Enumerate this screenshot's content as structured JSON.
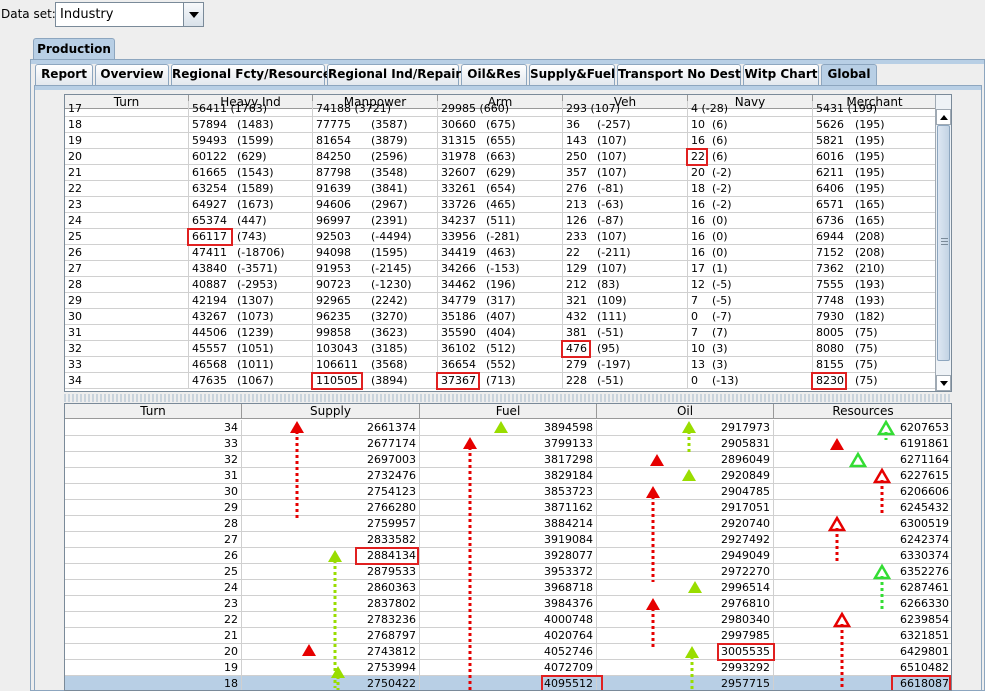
{
  "dataset": {
    "label": "Data set:",
    "value": "Industry"
  },
  "outer_tab": "Production",
  "tabs": [
    "Report",
    "Overview",
    "Regional Fcty/Resources",
    "Regional Ind/Repair",
    "Oil&Res",
    "Supply&Fuel",
    "Transport No Dest",
    "Witp Chart",
    "Global"
  ],
  "selected_tab": "Global",
  "production_table": {
    "columns": [
      "Turn",
      "Heavy Ind",
      "Manpower",
      "Arm",
      "Veh",
      "Navy",
      "Merchant"
    ],
    "partial_top_row": [
      "17",
      "56411 (1763)",
      "74188 (3721)",
      "29985 (660)",
      "293 (107)",
      "4 (-28)",
      "5431 (199)"
    ],
    "rows": [
      [
        "18",
        "57894",
        "(1483)",
        "77775",
        "(3587)",
        "30660",
        "(675)",
        "36",
        "(-257)",
        "10",
        "(6)",
        "5626",
        "(195)"
      ],
      [
        "19",
        "59493",
        "(1599)",
        "81654",
        "(3879)",
        "31315",
        "(655)",
        "143",
        "(107)",
        "16",
        "(6)",
        "5821",
        "(195)"
      ],
      [
        "20",
        "60122",
        "(629)",
        "84250",
        "(2596)",
        "31978",
        "(663)",
        "250",
        "(107)",
        "22",
        "(6)",
        "6016",
        "(195)"
      ],
      [
        "21",
        "61665",
        "(1543)",
        "87798",
        "(3548)",
        "32607",
        "(629)",
        "357",
        "(107)",
        "20",
        "(-2)",
        "6211",
        "(195)"
      ],
      [
        "22",
        "63254",
        "(1589)",
        "91639",
        "(3841)",
        "33261",
        "(654)",
        "276",
        "(-81)",
        "18",
        "(-2)",
        "6406",
        "(195)"
      ],
      [
        "23",
        "64927",
        "(1673)",
        "94606",
        "(2967)",
        "33726",
        "(465)",
        "213",
        "(-63)",
        "16",
        "(-2)",
        "6571",
        "(165)"
      ],
      [
        "24",
        "65374",
        "(447)",
        "96997",
        "(2391)",
        "34237",
        "(511)",
        "126",
        "(-87)",
        "16",
        "(0)",
        "6736",
        "(165)"
      ],
      [
        "25",
        "66117",
        "(743)",
        "92503",
        "(-4494)",
        "33956",
        "(-281)",
        "233",
        "(107)",
        "16",
        "(0)",
        "6944",
        "(208)"
      ],
      [
        "26",
        "47411",
        "(-18706)",
        "94098",
        "(1595)",
        "34419",
        "(463)",
        "22",
        "(-211)",
        "16",
        "(0)",
        "7152",
        "(208)"
      ],
      [
        "27",
        "43840",
        "(-3571)",
        "91953",
        "(-2145)",
        "34266",
        "(-153)",
        "129",
        "(107)",
        "17",
        "(1)",
        "7362",
        "(210)"
      ],
      [
        "28",
        "40887",
        "(-2953)",
        "90723",
        "(-1230)",
        "34462",
        "(196)",
        "212",
        "(83)",
        "12",
        "(-5)",
        "7555",
        "(193)"
      ],
      [
        "29",
        "42194",
        "(1307)",
        "92965",
        "(2242)",
        "34779",
        "(317)",
        "321",
        "(109)",
        "7",
        "(-5)",
        "7748",
        "(193)"
      ],
      [
        "30",
        "43267",
        "(1073)",
        "96235",
        "(3270)",
        "35186",
        "(407)",
        "432",
        "(111)",
        "0",
        "(-7)",
        "7930",
        "(182)"
      ],
      [
        "31",
        "44506",
        "(1239)",
        "99858",
        "(3623)",
        "35590",
        "(404)",
        "381",
        "(-51)",
        "7",
        "(7)",
        "8005",
        "(75)"
      ],
      [
        "32",
        "45557",
        "(1051)",
        "103043",
        "(3185)",
        "36102",
        "(512)",
        "476",
        "(95)",
        "10",
        "(3)",
        "8080",
        "(75)"
      ],
      [
        "33",
        "46568",
        "(1011)",
        "106611",
        "(3568)",
        "36654",
        "(552)",
        "279",
        "(-197)",
        "13",
        "(3)",
        "8155",
        "(75)"
      ],
      [
        "34",
        "47635",
        "(1067)",
        "110505",
        "(3894)",
        "37367",
        "(713)",
        "228",
        "(-51)",
        "0",
        "(-13)",
        "8230",
        "(75)"
      ]
    ]
  },
  "global_table": {
    "columns": [
      "Turn",
      "Supply",
      "Fuel",
      "Oil",
      "Resources"
    ],
    "rows": [
      [
        "34",
        "2661374",
        "3894598",
        "2917973",
        "6207653"
      ],
      [
        "33",
        "2677174",
        "3799133",
        "2905831",
        "6191861"
      ],
      [
        "32",
        "2697003",
        "3817298",
        "2896049",
        "6271164"
      ],
      [
        "31",
        "2732476",
        "3829184",
        "2920849",
        "6227615"
      ],
      [
        "30",
        "2754123",
        "3853723",
        "2904785",
        "6206606"
      ],
      [
        "29",
        "2766280",
        "3871162",
        "2917051",
        "6245432"
      ],
      [
        "28",
        "2759957",
        "3884214",
        "2920740",
        "6300519"
      ],
      [
        "27",
        "2833582",
        "3919084",
        "2927492",
        "6242374"
      ],
      [
        "26",
        "2884134",
        "3928077",
        "2949049",
        "6330374"
      ],
      [
        "25",
        "2879533",
        "3953372",
        "2972270",
        "6352276"
      ],
      [
        "24",
        "2860363",
        "3968718",
        "2996514",
        "6287461"
      ],
      [
        "23",
        "2837802",
        "3984376",
        "2976810",
        "6266330"
      ],
      [
        "22",
        "2783236",
        "4000748",
        "2980340",
        "6239854"
      ],
      [
        "21",
        "2768797",
        "4020764",
        "2997985",
        "6321851"
      ],
      [
        "20",
        "2743812",
        "4052746",
        "3005535",
        "6429801"
      ],
      [
        "19",
        "2753994",
        "4072709",
        "2993292",
        "6510482"
      ],
      [
        "18",
        "2750422",
        "4095512",
        "2957715",
        "6618087"
      ]
    ]
  },
  "colors": {
    "red": "#e60000",
    "green": "#99dd00",
    "outline_green": "#33dd33",
    "highlight": "#e02020",
    "tab_blue": "#b8cfe5"
  }
}
